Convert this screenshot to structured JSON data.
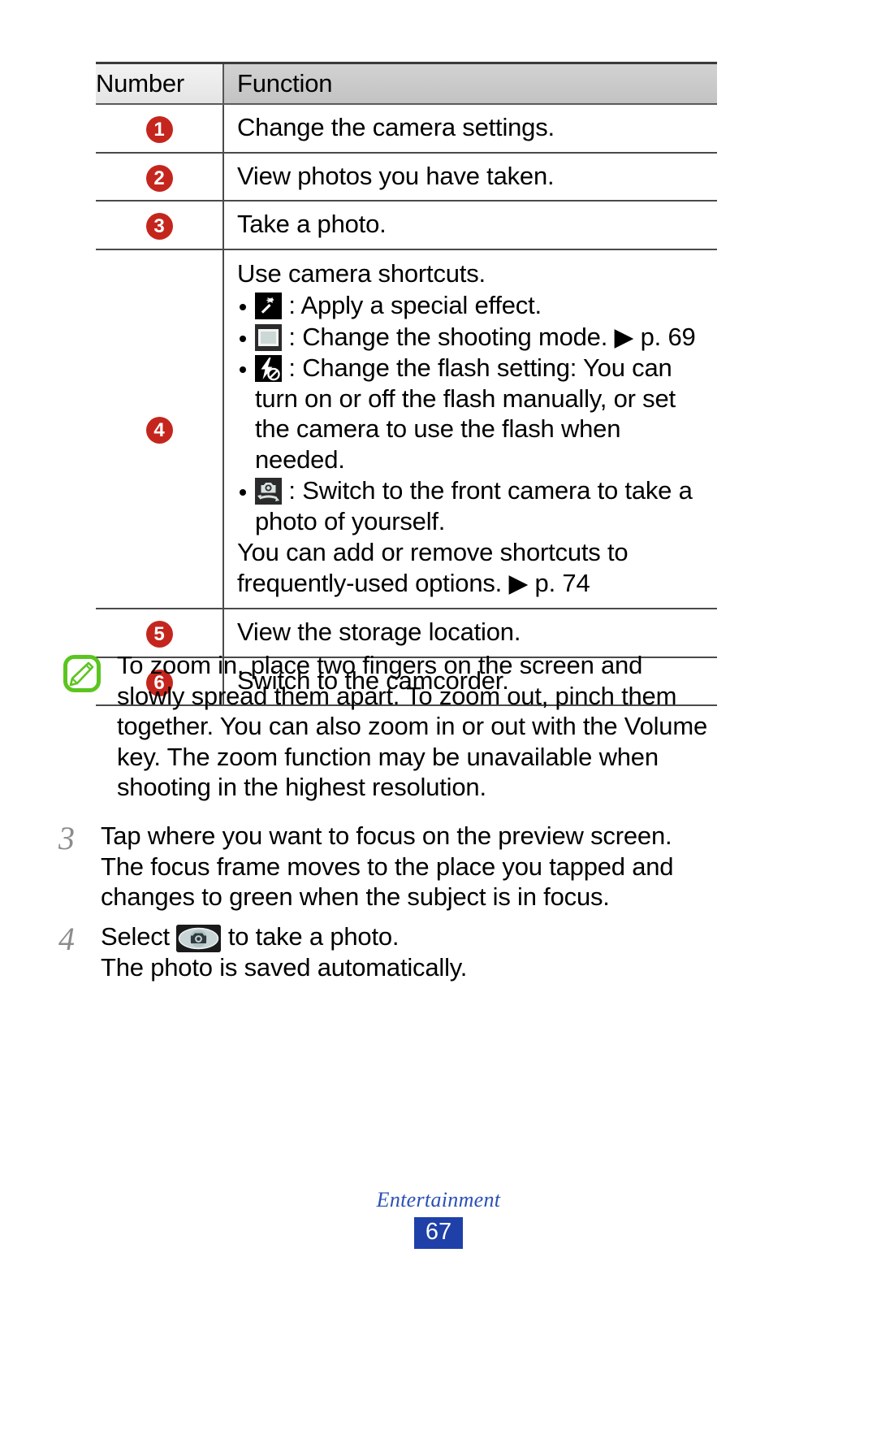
{
  "table": {
    "headers": [
      "Number",
      "Function"
    ],
    "rows": [
      {
        "number": "1",
        "function": "Change the camera settings."
      },
      {
        "number": "2",
        "function": "View photos you have taken."
      },
      {
        "number": "3",
        "function": "Take a photo."
      },
      {
        "number": "4",
        "intro": "Use camera shortcuts.",
        "bullets": [
          {
            "icon": "special-effect-icon",
            "text": ": Apply a special effect."
          },
          {
            "icon": "shooting-mode-icon",
            "text": ": Change the shooting mode. ▶ p. 69"
          },
          {
            "icon": "flash-setting-icon",
            "text": ": Change the flash setting: You can turn on or off the flash manually, or set the camera to use the flash when needed."
          },
          {
            "icon": "front-camera-icon",
            "text": ": Switch to the front camera to take a photo of yourself."
          }
        ],
        "tail": "You can add or remove shortcuts to frequently-used options. ▶ p. 74"
      },
      {
        "number": "5",
        "function": "View the storage location."
      },
      {
        "number": "6",
        "function": "Switch to the camcorder."
      }
    ]
  },
  "note": {
    "icon": "note-pencil-icon",
    "text": "To zoom in, place two fingers on the screen and slowly spread them apart. To zoom out, pinch them together. You can also zoom in or out with the Volume key. The zoom function may be unavailable when shooting in the highest resolution."
  },
  "steps": [
    {
      "number": "3",
      "text": "Tap where you want to focus on the preview screen. The focus frame moves to the place you tapped and changes to green when the subject is in focus."
    },
    {
      "number": "4",
      "text_before": "Select",
      "icon": "shutter-button-icon",
      "text_after": "to take a photo.",
      "text_second_line": "The photo is saved automatically."
    }
  ],
  "footer": {
    "title": "Entertainment",
    "page_number": "67"
  },
  "colors": {
    "badge_red": "#c4261d",
    "note_green": "#5bc520",
    "footer_blue": "#1f40a8",
    "footer_title_blue": "#2a4fb8",
    "step_num_gray": "#8c8c8c"
  }
}
